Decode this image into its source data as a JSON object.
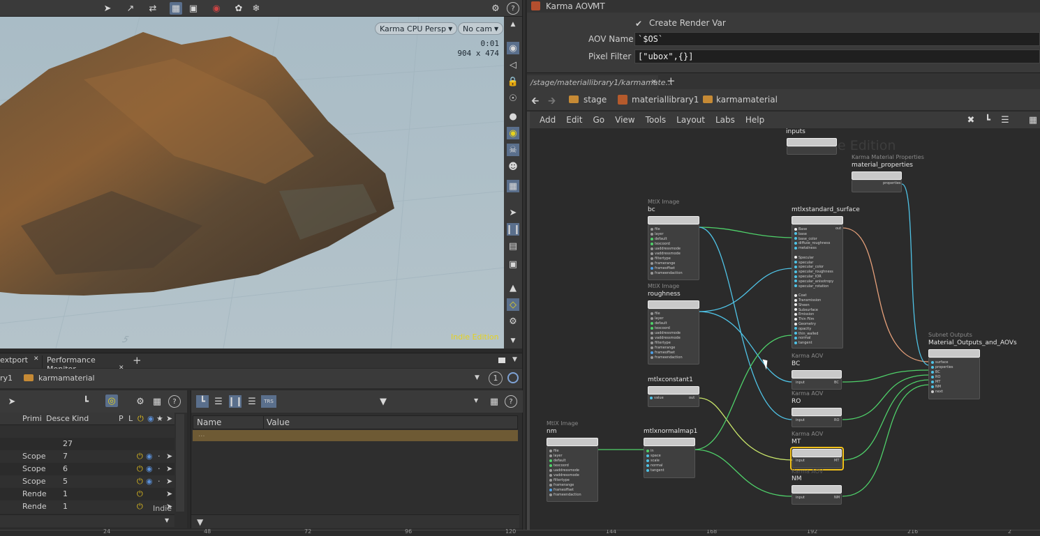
{
  "viewport": {
    "toolbar_icons": [
      "select-arrow-icon",
      "transform-icon",
      "pose-icon",
      "snapshot-icon",
      "render-region-icon",
      "record-icon",
      "handle-icon",
      "gear-icon",
      "help-icon"
    ],
    "renderer_pill": "Karma CPU  Persp",
    "camera_pill": "No cam",
    "render_time": "0:01",
    "render_resolution": "904 x 474",
    "watermark": "Indie Edition",
    "grid_label": "5"
  },
  "lower_tabs": {
    "tab1": "extport",
    "tab2": "Performance Monitor",
    "add": "+"
  },
  "scene_path": {
    "left": "ry1",
    "node": "karmamaterial",
    "badge": "1"
  },
  "scene_tree": {
    "columns": [
      "Primi",
      "Desce",
      "Kind",
      "P",
      "L"
    ],
    "rows": [
      {
        "primi": "",
        "desce": "",
        "kind": ""
      },
      {
        "primi": "",
        "desce": "27",
        "kind": ""
      },
      {
        "primi": "Scope",
        "desce": "7",
        "kind": ""
      },
      {
        "primi": "Scope",
        "desce": "6",
        "kind": ""
      },
      {
        "primi": "Scope",
        "desce": "5",
        "kind": ""
      },
      {
        "primi": "Rende",
        "desce": "1",
        "kind": ""
      },
      {
        "primi": "Rende",
        "desce": "1",
        "kind": ""
      }
    ],
    "watermark": "Indie"
  },
  "properties_table": {
    "col_name": "Name",
    "col_value": "Value",
    "placeholder": "..."
  },
  "parm_panel": {
    "node_type": "Karma AOV",
    "node_name": "MT",
    "create_render_var": "Create Render Var",
    "aov_name_label": "AOV Name",
    "aov_name_value": "`$OS`",
    "pixel_filter_label": "Pixel Filter",
    "pixel_filter_value": "[\"ubox\",{}]"
  },
  "network": {
    "tab_path": "/stage/materiallibrary1/karmamate...",
    "breadcrumb": [
      "stage",
      "materiallibrary1",
      "karmamaterial"
    ],
    "menu": [
      "Add",
      "Edit",
      "Go",
      "View",
      "Tools",
      "Layout",
      "Labs",
      "Help"
    ],
    "watermark": "Indie Edition",
    "nodes": {
      "inputs": {
        "name": "inputs"
      },
      "matprops": {
        "type": "Karma Material Properties",
        "name": "material_properties",
        "port": "properties"
      },
      "bc": {
        "type": "MtlX Image",
        "name": "bc"
      },
      "roughness": {
        "type": "MtlX Image",
        "name": "roughness"
      },
      "nm": {
        "type": "MtlX Image",
        "name": "nm"
      },
      "stdsurf": {
        "name": "mtlxstandard_surface",
        "out": "out"
      },
      "constant": {
        "name": "mtlxconstant1",
        "port": "value",
        "out": "out"
      },
      "normalmap": {
        "name": "mtlxnormalmap1"
      },
      "aov_bc": {
        "type": "Karma AOV",
        "name": "BC",
        "in": "input",
        "out": "BC"
      },
      "aov_ro": {
        "type": "Karma AOV",
        "name": "RO",
        "in": "input",
        "out": "RO"
      },
      "aov_mt": {
        "type": "Karma AOV",
        "name": "MT",
        "in": "input",
        "out": "MT"
      },
      "aov_nm": {
        "type": "Karma AOV",
        "name": "NM",
        "in": "input",
        "out": "NM"
      },
      "outputs": {
        "type": "Subnet Outputs",
        "name": "Material_Outputs_and_AOVs"
      }
    },
    "image_ports": [
      "file",
      "layer",
      "default",
      "texcoord",
      "uaddressmode",
      "vaddressmode",
      "filtertype",
      "framerange",
      "frameoffset",
      "frameendaction"
    ],
    "surf_ports": [
      "Base",
      "base",
      "base_color",
      "diffuse_roughness",
      "metalness",
      "",
      "Specular",
      "specular",
      "specular_color",
      "specular_roughness",
      "specular_IOR",
      "specular_anisotropy",
      "specular_rotation",
      "",
      "Coat",
      "Transmission",
      "Sheen",
      "Subsurface",
      "Emission",
      "Thin Film",
      "Geometry",
      "opacity",
      "thin_walled",
      "normal",
      "tangent"
    ],
    "normal_ports": [
      "in",
      "space",
      "scale",
      "normal",
      "tangent"
    ],
    "output_ports": [
      "surface",
      "properties",
      "BC",
      "RO",
      "MT",
      "NM",
      "next"
    ]
  },
  "timeline": {
    "ticks": [
      "24",
      "48",
      "72",
      "96",
      "120",
      "144",
      "168",
      "192",
      "216",
      "2"
    ]
  }
}
